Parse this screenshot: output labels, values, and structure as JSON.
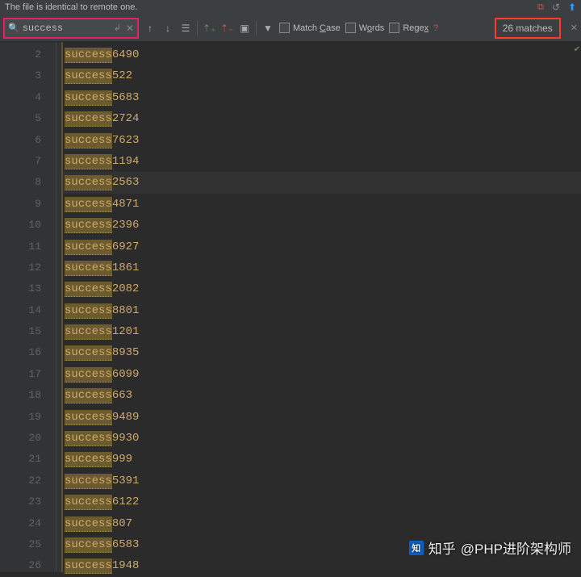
{
  "status": {
    "message": "The file is identical to remote one."
  },
  "find": {
    "query": "success",
    "match_case": "Match Case",
    "words": "Words",
    "regex": "Regex",
    "matches_label": "26 matches"
  },
  "highlight_term": "success",
  "lines": [
    {
      "num": 2,
      "text": "success6490"
    },
    {
      "num": 3,
      "text": "success522"
    },
    {
      "num": 4,
      "text": "success5683"
    },
    {
      "num": 5,
      "text": "success2724"
    },
    {
      "num": 6,
      "text": "success7623"
    },
    {
      "num": 7,
      "text": "success1194"
    },
    {
      "num": 8,
      "text": "success2563",
      "active": true
    },
    {
      "num": 9,
      "text": "success4871"
    },
    {
      "num": 10,
      "text": "success2396"
    },
    {
      "num": 11,
      "text": "success6927"
    },
    {
      "num": 12,
      "text": "success1861"
    },
    {
      "num": 13,
      "text": "success2082"
    },
    {
      "num": 14,
      "text": "success8801"
    },
    {
      "num": 15,
      "text": "success1201"
    },
    {
      "num": 16,
      "text": "success8935"
    },
    {
      "num": 17,
      "text": "success6099"
    },
    {
      "num": 18,
      "text": "success663"
    },
    {
      "num": 19,
      "text": "success9489"
    },
    {
      "num": 20,
      "text": "success9930"
    },
    {
      "num": 21,
      "text": "success999"
    },
    {
      "num": 22,
      "text": "success5391"
    },
    {
      "num": 23,
      "text": "success6122"
    },
    {
      "num": 24,
      "text": "success807"
    },
    {
      "num": 25,
      "text": "success6583"
    },
    {
      "num": 26,
      "text": "success1948"
    }
  ],
  "watermark": {
    "site": "知乎",
    "author": "@PHP进阶架构师"
  }
}
